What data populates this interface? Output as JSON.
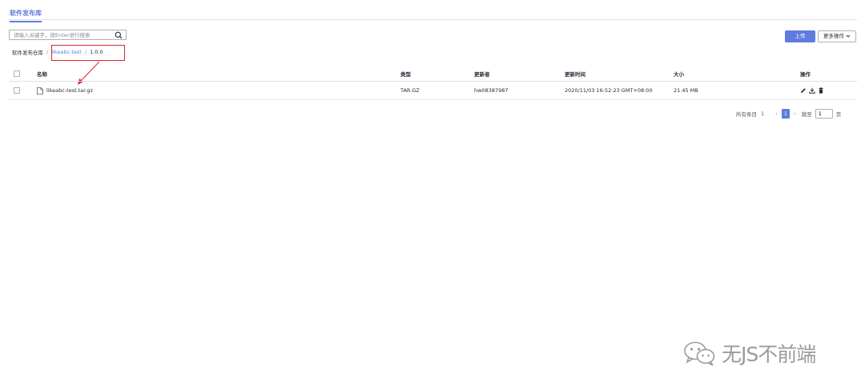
{
  "tabs": [
    {
      "label": "软件发布库",
      "active": true
    }
  ],
  "search": {
    "placeholder": "请输入关键字，按Enter进行搜索",
    "value": ""
  },
  "toolbar": {
    "upload_label": "上传",
    "more_label": "更多操作"
  },
  "breadcrumb": {
    "root": "软件发布仓库",
    "separator": "/",
    "repo": "likeabc-test",
    "version": "1.0.0"
  },
  "table": {
    "columns": [
      "名称",
      "类型",
      "更新者",
      "更新时间",
      "大小",
      "操作"
    ],
    "rows": [
      {
        "name": "likeabc-test.tar.gz",
        "type": "TAR.GZ",
        "updater": "hw08387987",
        "time": "2020/11/03 16:52:23 GMT+08:00",
        "size": "21.45 MB"
      }
    ],
    "row_actions": [
      "edit-icon",
      "download-icon",
      "delete-icon"
    ]
  },
  "pagination": {
    "total_label": "所有条目",
    "total": "1",
    "current_page": "1",
    "prev": "‹",
    "next": "›",
    "goto_label": "跳至",
    "goto_value": "1",
    "page_unit": "页"
  },
  "watermark": {
    "text": "无JS不前端"
  },
  "colors": {
    "accent": "#5e7ce0",
    "annotation": "#e0262c",
    "text": "#252b3a",
    "border": "#dfe1e6"
  }
}
